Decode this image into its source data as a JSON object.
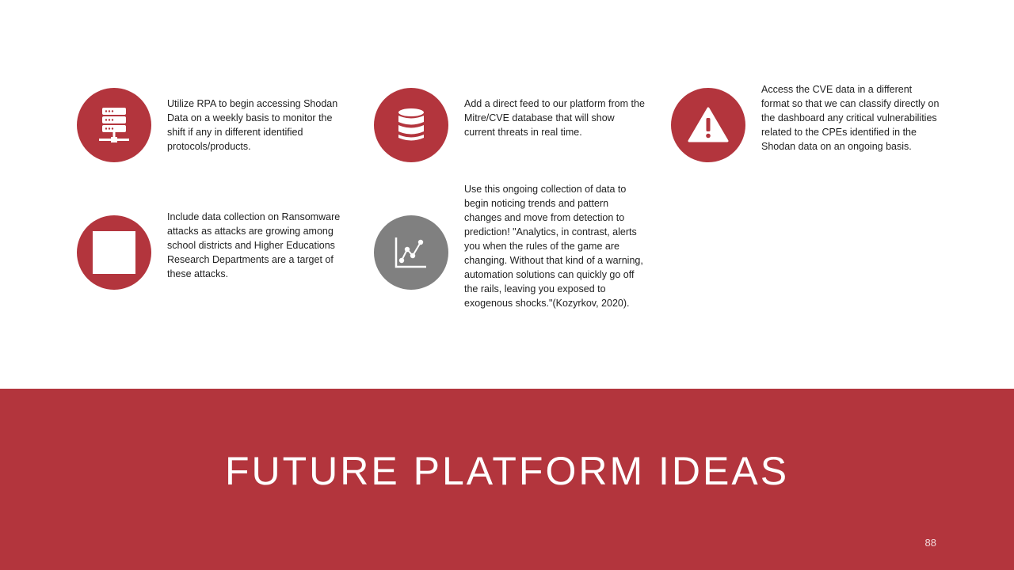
{
  "slide": {
    "title": "FUTURE PLATFORM IDEAS",
    "page_number": "88"
  },
  "colors": {
    "accent": "#b3353d",
    "icon_gray": "#808080",
    "background": "#ffffff",
    "title_text": "#ffffff"
  },
  "ideas": [
    {
      "icon": "server-icon",
      "text": "Utilize RPA to begin accessing Shodan Data on a weekly basis to monitor the shift if any in different identified protocols/products."
    },
    {
      "icon": "database-icon",
      "text": "Add a direct feed to our platform from the Mitre/CVE database that will show current threats in real time."
    },
    {
      "icon": "warning-icon",
      "text": "Access the CVE data in a different format so that we can classify directly on the dashboard any critical vulnerabilities related to the CPEs identified in the Shodan data on an ongoing basis."
    },
    {
      "icon": "blank-square-icon",
      "text": "Include data collection on Ransomware attacks as attacks are growing among school districts and Higher Educations Research Departments are a target of these attacks."
    },
    {
      "icon": "line-chart-icon",
      "text": "Use this ongoing collection of data to begin noticing trends and pattern changes and move from detection to prediction!  \"Analytics, in contrast, alerts you when the rules of the game are changing. Without that kind of a warning, automation solutions can quickly go off the rails, leaving you exposed to exogenous shocks.\"(Kozyrkov, 2020)."
    }
  ]
}
